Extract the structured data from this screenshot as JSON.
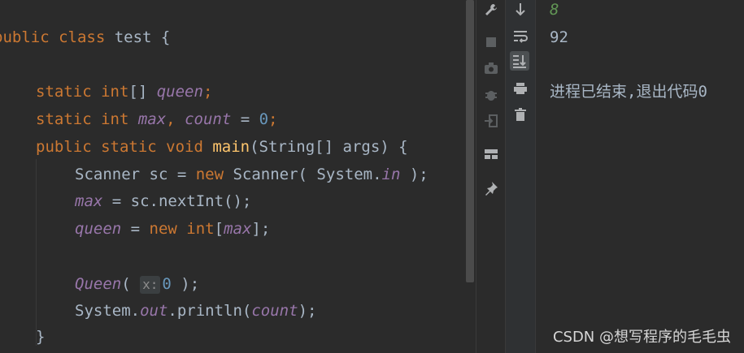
{
  "editor": {
    "lines": {
      "l1": {
        "a": "public class ",
        "b": "test",
        "c": " {"
      },
      "l2": {
        "a": "static ",
        "b": "int",
        "c": "[] ",
        "d": "queen",
        "e": ";"
      },
      "l3": {
        "a": "static ",
        "b": "int ",
        "c": "max",
        "d": ", ",
        "e": "count",
        "f": " = ",
        "g": "0",
        "h": ";"
      },
      "l4": {
        "a": "public static void ",
        "b": "main",
        "c": "(String[] args) {"
      },
      "l5": {
        "a": "Scanner sc = ",
        "b": "new",
        "c": " Scanner( System.",
        "d": "in",
        "e": " );"
      },
      "l6": {
        "a": "max",
        "b": " = sc.nextInt();"
      },
      "l7": {
        "a": "queen",
        "b": " = ",
        "c": "new int",
        "d": "[",
        "e": "max",
        "f": "];"
      },
      "l8": {
        "a": "Queen",
        "b": "( ",
        "hint": "x:",
        "c": "0",
        "d": " );"
      },
      "l9": {
        "a": "System.",
        "b": "out",
        "c": ".println(",
        "d": "count",
        "e": ");"
      },
      "l10": {
        "a": "}"
      }
    }
  },
  "toolbar_left": {
    "icons": [
      "wrench-icon",
      "stop-icon",
      "camera-icon",
      "bug-icon",
      "exit-icon",
      "layout-icon",
      "pin-icon"
    ]
  },
  "toolbar_right": {
    "icons": [
      "arrow-down-icon",
      "soft-wrap-icon",
      "scroll-to-end-icon",
      "print-icon",
      "trash-icon"
    ]
  },
  "console": {
    "line1": "8",
    "line2": "92",
    "exit_message": "进程已结束,退出代码0"
  },
  "watermark": "CSDN @想写程序的毛毛虫",
  "colors": {
    "background": "#2b2b2b",
    "keyword": "#cc7832",
    "field": "#9876aa",
    "number": "#6897bb",
    "function": "#ffc66d",
    "text": "#a9b7c6",
    "console_input": "#629755"
  }
}
